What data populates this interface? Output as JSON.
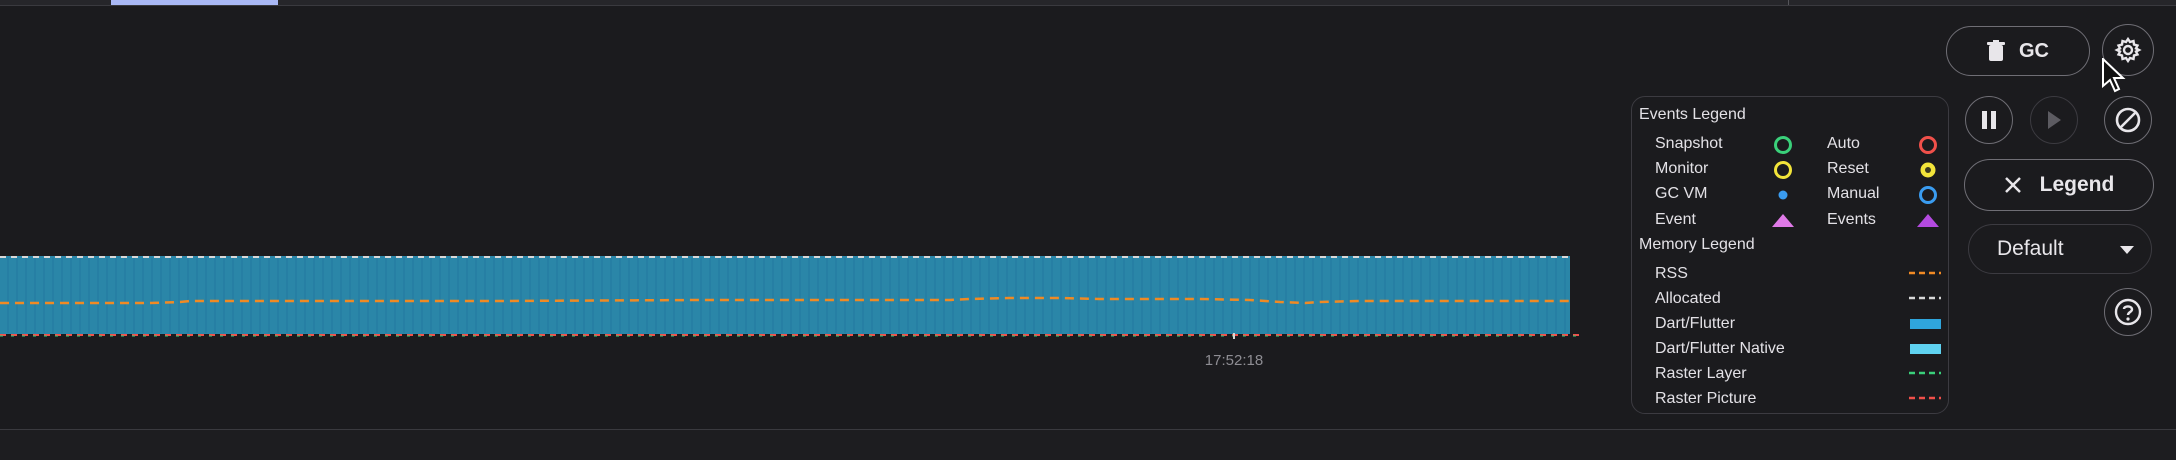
{
  "colors": {
    "background": "#1b1b1e",
    "memory_fill": "#2a86a8",
    "rss_line": "#f08a24",
    "allocated_line": "#d8d8d8",
    "raster_layer_line": "#3ad07a",
    "raster_picture_line": "#f0504a",
    "tab_indicator": "#a9b8f5"
  },
  "chart": {
    "time_label": "17:52:18"
  },
  "controls": {
    "gc_label": "GC",
    "legend_label": "Legend",
    "dropdown_value": "Default",
    "icons": [
      "trash-icon",
      "gear-icon",
      "pause-icon",
      "play-icon",
      "clear-icon",
      "close-icon",
      "dropdown-arrow-icon",
      "help-icon"
    ]
  },
  "legend": {
    "events_title": "Events Legend",
    "events": [
      {
        "label": "Snapshot",
        "icon": "green-ring"
      },
      {
        "label": "Auto",
        "icon": "red-ring"
      },
      {
        "label": "Monitor",
        "icon": "yellow-ring"
      },
      {
        "label": "Reset",
        "icon": "yellow-dot-ring"
      },
      {
        "label": "GC VM",
        "icon": "blue-dot"
      },
      {
        "label": "Manual",
        "icon": "blue-ring"
      },
      {
        "label": "Event",
        "icon": "pink-triangle"
      },
      {
        "label": "Events",
        "icon": "purple-triangle"
      }
    ],
    "memory_title": "Memory Legend",
    "memory": [
      {
        "label": "RSS",
        "icon": "orange-dashed-line"
      },
      {
        "label": "Allocated",
        "icon": "white-dashed-line"
      },
      {
        "label": "Dart/Flutter",
        "icon": "blue-bar"
      },
      {
        "label": "Dart/Flutter Native",
        "icon": "light-blue-bar"
      },
      {
        "label": "Raster Layer",
        "icon": "green-dashed-line"
      },
      {
        "label": "Raster Picture",
        "icon": "red-dashed-line"
      }
    ]
  }
}
